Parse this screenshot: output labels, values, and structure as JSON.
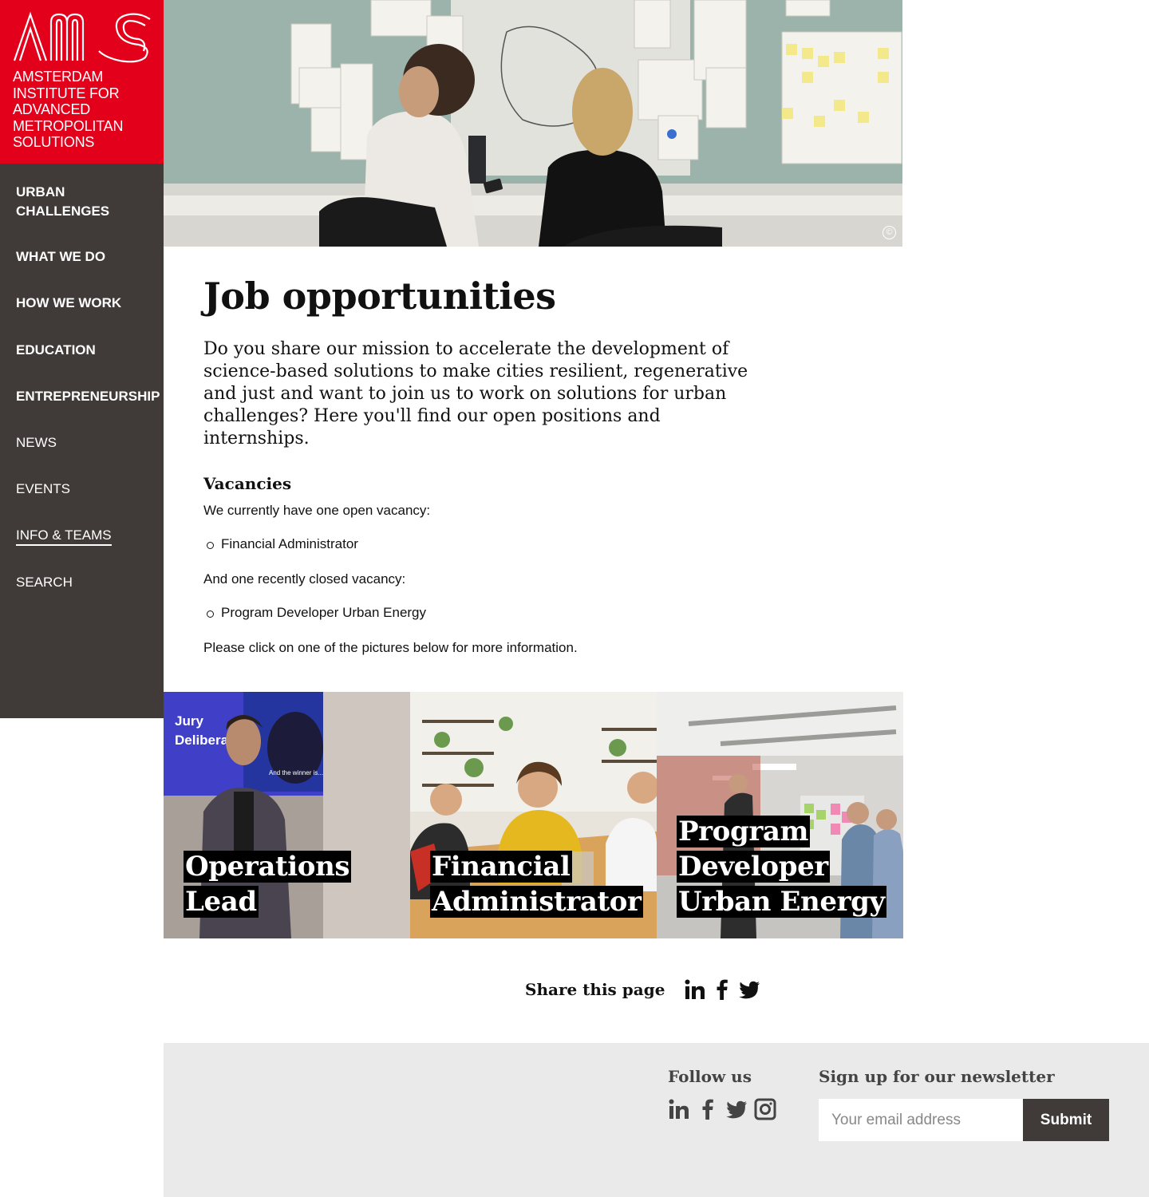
{
  "logo": {
    "mark": "AMS",
    "line1": "AMSTERDAM",
    "line2": "INSTITUTE FOR",
    "line3": "ADVANCED",
    "line4": "METROPOLITAN",
    "line5": "SOLUTIONS",
    "color": "#e3001b"
  },
  "nav": {
    "items": [
      {
        "label_line1": "URBAN",
        "label_line2": "CHALLENGES"
      },
      {
        "label": "WHAT WE DO"
      },
      {
        "label": "HOW WE WORK"
      },
      {
        "label": "EDUCATION"
      },
      {
        "label": "ENTREPRENEURSHIP"
      },
      {
        "label": "NEWS"
      },
      {
        "label": "EVENTS"
      },
      {
        "label": "INFO & TEAMS",
        "active": true
      },
      {
        "label": "SEARCH"
      }
    ]
  },
  "hero": {
    "copyright_symbol": "©"
  },
  "main": {
    "title": "Job opportunities",
    "intro": "Do you share our mission to accelerate the development of science-based solutions to make cities resilient, regenerative and just and want to join us to work on solutions for urban challenges? Here you'll find our open positions and internships.",
    "vacancies_heading": "Vacancies",
    "open_text": "We currently have one open vacancy:",
    "open_list": [
      "Financial Administrator"
    ],
    "closed_text": "And one recently closed vacancy:",
    "closed_list": [
      "Program Developer Urban Energy"
    ],
    "click_text": "Please click on one of the pictures below for more information."
  },
  "cards": [
    {
      "title_line1": "Operations",
      "title_line2": "Lead",
      "photo_text_1": "Jury",
      "photo_text_2": "Delibera",
      "photo_text_3": "And the winner is..."
    },
    {
      "title_line1": "Financial",
      "title_line2": "Administrator"
    },
    {
      "title_line1": "Program",
      "title_line2": "Developer",
      "title_line3": "Urban Energy"
    }
  ],
  "share": {
    "label": "Share this page",
    "icons": [
      "linkedin-icon",
      "facebook-icon",
      "twitter-icon"
    ]
  },
  "footer": {
    "follow_heading": "Follow us",
    "follow_icons": [
      "linkedin-icon",
      "facebook-icon",
      "twitter-icon",
      "instagram-icon"
    ],
    "newsletter_heading": "Sign up for our newsletter",
    "email_placeholder": "Your email address",
    "submit_label": "Submit"
  }
}
